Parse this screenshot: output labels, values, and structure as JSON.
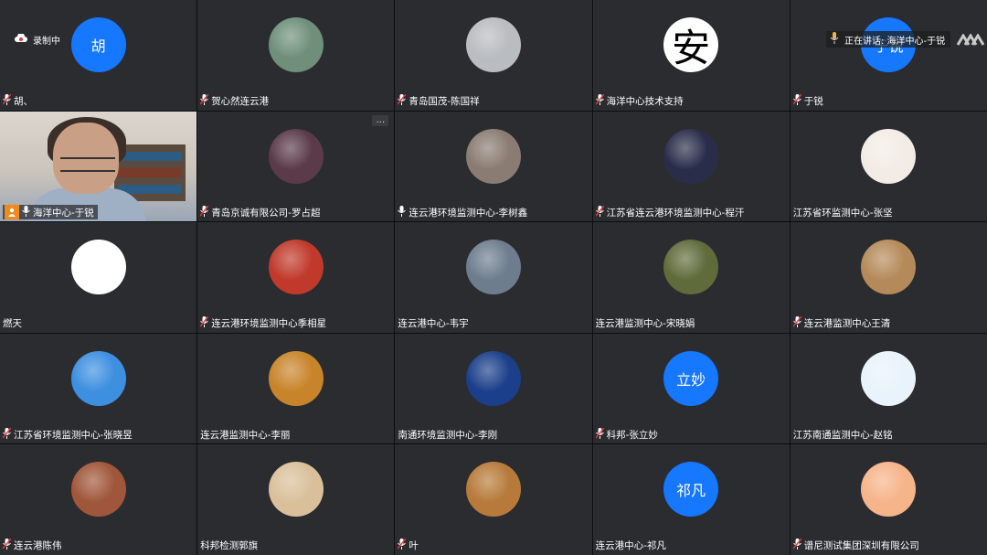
{
  "recording": {
    "label": "录制中",
    "icon": "cloud-record-icon"
  },
  "speaking": {
    "label": "正在讲话: 海洋中心-于锐",
    "icon": "mic-icon"
  },
  "colors": {
    "accent_blue": "#1677ff",
    "active_border": "#2fb35a",
    "tile_bg": "#2b2c30",
    "muted_mic": "#e0383e"
  },
  "tiles": [
    {
      "name": "胡、",
      "avatar": {
        "kind": "text",
        "text": "胡",
        "color": "#1677ff"
      },
      "mic": "muted"
    },
    {
      "name": "贺心然连云港",
      "avatar": {
        "kind": "image",
        "depicts": "mountain-lake-photo",
        "color": "#6f8f7a"
      },
      "mic": "muted"
    },
    {
      "name": "青岛国茂-陈国祥",
      "avatar": {
        "kind": "image",
        "depicts": "person-on-beach-photo",
        "color": "#b9bcc0"
      },
      "mic": "muted"
    },
    {
      "name": "海洋中心技术支持",
      "avatar": {
        "kind": "char",
        "text": "安",
        "color": "#ffffff"
      },
      "mic": "muted"
    },
    {
      "name": "于锐",
      "avatar": {
        "kind": "text",
        "text": "于锐",
        "color": "#1677ff"
      },
      "mic": "muted"
    },
    {
      "name": "海洋中心-于锐",
      "avatar": {
        "kind": "video",
        "depicts": "live-camera-video"
      },
      "mic": "speaking",
      "active": true,
      "badge": "person-badge-icon"
    },
    {
      "name": "青岛京诚有限公司-罗占超",
      "avatar": {
        "kind": "image",
        "depicts": "basketball-player-photo",
        "color": "#5b3a4a"
      },
      "mic": "muted",
      "menu": "..."
    },
    {
      "name": "连云港环境监测中心-李树鑫",
      "avatar": {
        "kind": "image",
        "depicts": "cat-photo",
        "color": "#8a7c72"
      },
      "mic": "on"
    },
    {
      "name": "江苏省连云港环境监测中心-程汗",
      "avatar": {
        "kind": "image",
        "depicts": "anime-character-avatar",
        "color": "#2a2d4a"
      },
      "mic": "muted"
    },
    {
      "name": "江苏省环监测中心-张坚",
      "avatar": {
        "kind": "image",
        "depicts": "cartoon-boy-avatar",
        "color": "#f3ece6"
      },
      "mic": "none"
    },
    {
      "name": "燃天",
      "avatar": {
        "kind": "image",
        "depicts": "cartoon-figure-avatar",
        "color": "#ffffff"
      },
      "mic": "none"
    },
    {
      "name": "连云港环境监测中心季相星",
      "avatar": {
        "kind": "image",
        "depicts": "red-ornament-photo",
        "color": "#c0392b"
      },
      "mic": "muted"
    },
    {
      "name": "连云港中心-韦宇",
      "avatar": {
        "kind": "image",
        "depicts": "dog-photo",
        "color": "#6d7d8e"
      },
      "mic": "none"
    },
    {
      "name": "连云港监测中心-宋晓娟",
      "avatar": {
        "kind": "image",
        "depicts": "waterfall-forest-photo",
        "color": "#5f6b3a"
      },
      "mic": "none"
    },
    {
      "name": "连云港监测中心王清",
      "avatar": {
        "kind": "image",
        "depicts": "sunset-cliff-photo",
        "color": "#b58a5a"
      },
      "mic": "muted"
    },
    {
      "name": "江苏省环境监测中心-张晓昱",
      "avatar": {
        "kind": "image",
        "depicts": "cartoon-man-glasses-avatar",
        "color": "#3d8fe0"
      },
      "mic": "muted"
    },
    {
      "name": "连云港监测中心-李丽",
      "avatar": {
        "kind": "image",
        "depicts": "autumn-scene-photo",
        "color": "#c8842a"
      },
      "mic": "none"
    },
    {
      "name": "南通环境监测中心-李刚",
      "avatar": {
        "kind": "image",
        "depicts": "earth-from-space-photo",
        "color": "#1b3f8a"
      },
      "mic": "none"
    },
    {
      "name": "科邦-张立妙",
      "avatar": {
        "kind": "text",
        "text": "立妙",
        "color": "#1677ff"
      },
      "mic": "muted"
    },
    {
      "name": "江苏南通监测中心-赵铭",
      "avatar": {
        "kind": "image",
        "depicts": "doraemon-avatar",
        "color": "#e9f3fb"
      },
      "mic": "none"
    },
    {
      "name": "连云港陈伟",
      "avatar": {
        "kind": "image",
        "depicts": "cartoon-boy-portrait",
        "color": "#a0563a"
      },
      "mic": "muted"
    },
    {
      "name": "科邦检测郭旗",
      "avatar": {
        "kind": "image",
        "depicts": "girl-with-flowers-photo",
        "color": "#d9c09a"
      },
      "mic": "none"
    },
    {
      "name": "叶",
      "avatar": {
        "kind": "image",
        "depicts": "golden-retriever-photo",
        "color": "#b77a3a"
      },
      "mic": "muted"
    },
    {
      "name": "连云港中心-祁凡",
      "avatar": {
        "kind": "text",
        "text": "祁凡",
        "color": "#1677ff"
      },
      "mic": "none"
    },
    {
      "name": "谱尼测试集团深圳有限公司",
      "avatar": {
        "kind": "image",
        "depicts": "cartoon-bunny-avatar",
        "color": "#f6b48a"
      },
      "mic": "muted"
    }
  ]
}
